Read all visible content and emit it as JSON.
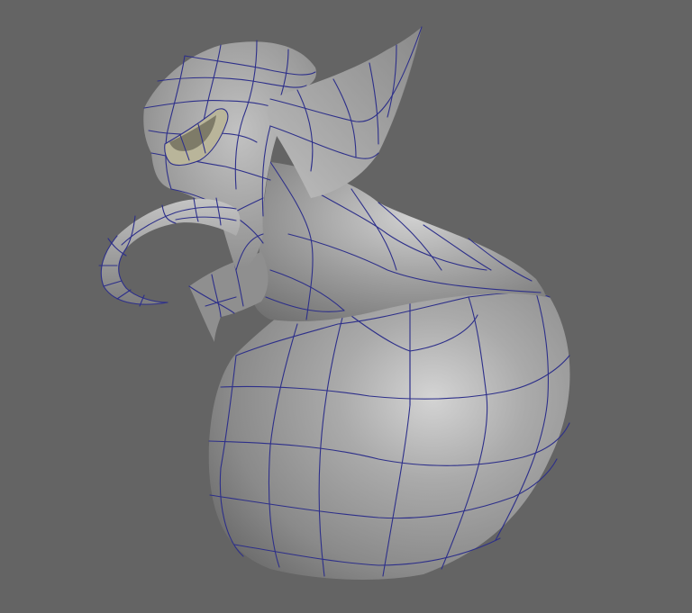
{
  "viewport": {
    "background": "#646464",
    "subject": "goblin-bust-wireframe-mesh",
    "shading": {
      "surface": "#9c9c9c",
      "highlight": "#c8c8c8",
      "shadow": "#6e6e6e",
      "wireframe": "#2d2f8a",
      "eye": "#b9b59a"
    }
  }
}
